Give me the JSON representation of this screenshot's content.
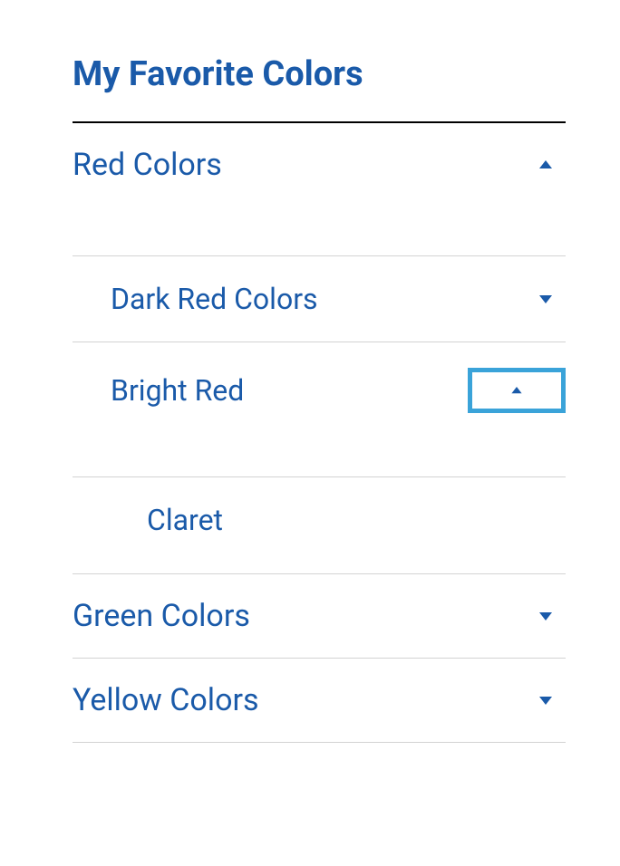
{
  "title": "My Favorite Colors",
  "sections": {
    "red": {
      "label": "Red Colors",
      "darkRed": {
        "label": "Dark Red Colors"
      },
      "brightRed": {
        "label": "Bright Red",
        "claret": {
          "label": "Claret"
        }
      }
    },
    "green": {
      "label": "Green Colors"
    },
    "yellow": {
      "label": "Yellow Colors"
    }
  }
}
